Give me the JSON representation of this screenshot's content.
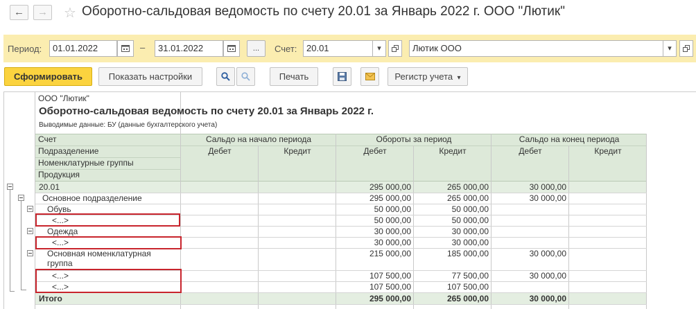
{
  "window": {
    "title": "Оборотно-сальдовая ведомость по счету 20.01 за Январь 2022 г. ООО \"Лютик\""
  },
  "nav": {
    "back": "←",
    "forward": "→",
    "star": "☆"
  },
  "filters": {
    "period_label": "Период:",
    "date_from": "01.01.2022",
    "dash": "–",
    "date_to": "31.01.2022",
    "more": "...",
    "account_label": "Счет:",
    "account": "20.01",
    "org": "Лютик ООО"
  },
  "toolbar": {
    "generate": "Сформировать",
    "settings": "Показать настройки",
    "print": "Печать",
    "register": "Регистр учета"
  },
  "report": {
    "org": "ООО \"Лютик\"",
    "heading": "Оборотно-сальдовая ведомость по счету 20.01 за Январь 2022 г.",
    "output_data": "Выводимые данные:   БУ (данные бухгалтерского учета)",
    "headers": {
      "account": "Счет",
      "division": "Подразделение",
      "nomenclature": "Номенклатурные группы",
      "product": "Продукция",
      "opening": "Сальдо на начало периода",
      "turnover": "Обороты за период",
      "closing": "Сальдо на конец периода",
      "debit": "Дебет",
      "credit": "Кредит"
    },
    "rows": [
      {
        "label": "20.01",
        "ob_d": "295 000,00",
        "ob_c": "265 000,00",
        "end_d": "30 000,00"
      },
      {
        "label": "Основное подразделение",
        "ob_d": "295 000,00",
        "ob_c": "265 000,00",
        "end_d": "30 000,00"
      },
      {
        "label": "Обувь",
        "ob_d": "50 000,00",
        "ob_c": "50 000,00",
        "end_d": ""
      },
      {
        "label": "<...>",
        "ob_d": "50 000,00",
        "ob_c": "50 000,00",
        "end_d": ""
      },
      {
        "label": "Одежда",
        "ob_d": "30 000,00",
        "ob_c": "30 000,00",
        "end_d": ""
      },
      {
        "label": "<...>",
        "ob_d": "30 000,00",
        "ob_c": "30 000,00",
        "end_d": ""
      },
      {
        "label": "Основная номенклатурная",
        "label2": "группа",
        "ob_d": "215 000,00",
        "ob_c": "185 000,00",
        "end_d": "30 000,00"
      },
      {
        "label": "<...>",
        "ob_d": "107 500,00",
        "ob_c": "77 500,00",
        "end_d": "30 000,00"
      },
      {
        "label": "<...>",
        "ob_d": "107 500,00",
        "ob_c": "107 500,00",
        "end_d": ""
      }
    ],
    "total": {
      "label": "Итого",
      "ob_d": "295 000,00",
      "ob_c": "265 000,00",
      "end_d": "30 000,00"
    }
  }
}
